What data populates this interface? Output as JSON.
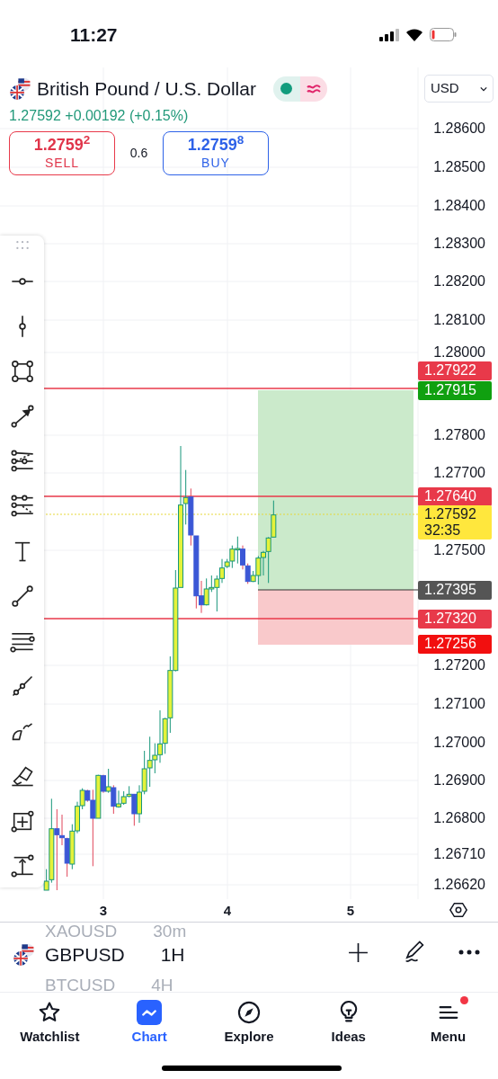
{
  "status_bar": {
    "time": "11:27"
  },
  "header": {
    "title": "British Pound / U.S. Dollar",
    "market_open": true,
    "quote": "1.27592 +0.00192 (+0.15%)",
    "currency": "USD",
    "sell": {
      "price": "1.2759$^{2}$",
      "label": "SELL"
    },
    "spread": "0.6",
    "buy": {
      "price": "1.2759$^{8}$",
      "label": "BUY"
    }
  },
  "price_axis": {
    "ticks": [
      "1.28600",
      "1.28500",
      "1.28400",
      "1.28300",
      "1.28200",
      "1.28100",
      "1.28000",
      "1.27800",
      "1.27700",
      "1.27500",
      "1.27200",
      "1.27100",
      "1.27000",
      "1.26900",
      "1.26800",
      "1.26710",
      "1.26620"
    ]
  },
  "price_labels": [
    {
      "text": "1.27922",
      "color": "#e8394a"
    },
    {
      "text": "1.27915",
      "color": "#10a010"
    },
    {
      "text": "1.27640",
      "color": "#e8394a"
    },
    {
      "text": "1.27592",
      "countdown": "32:35",
      "color": "#ffe73d"
    },
    {
      "text": "1.27395",
      "color": "#555555"
    },
    {
      "text": "1.27320",
      "color": "#e8394a"
    },
    {
      "text": "1.27256",
      "color": "#f20f0f"
    }
  ],
  "time_axis": {
    "labels": [
      "3",
      "4",
      "5"
    ]
  },
  "symbol_bar": {
    "previous": {
      "symbol": "XAOUSD",
      "interval": "30m"
    },
    "current": {
      "symbol": "GBPUSD",
      "interval": "1H"
    },
    "next": {
      "symbol": "BTCUSD",
      "interval": "4H"
    }
  },
  "nav": [
    {
      "label": "Watchlist",
      "selected": false,
      "badge": false
    },
    {
      "label": "Chart",
      "selected": true,
      "badge": false
    },
    {
      "label": "Explore",
      "selected": false,
      "badge": false
    },
    {
      "label": "Ideas",
      "selected": false,
      "badge": false
    },
    {
      "label": "Menu",
      "selected": false,
      "badge": true
    }
  ]
}
